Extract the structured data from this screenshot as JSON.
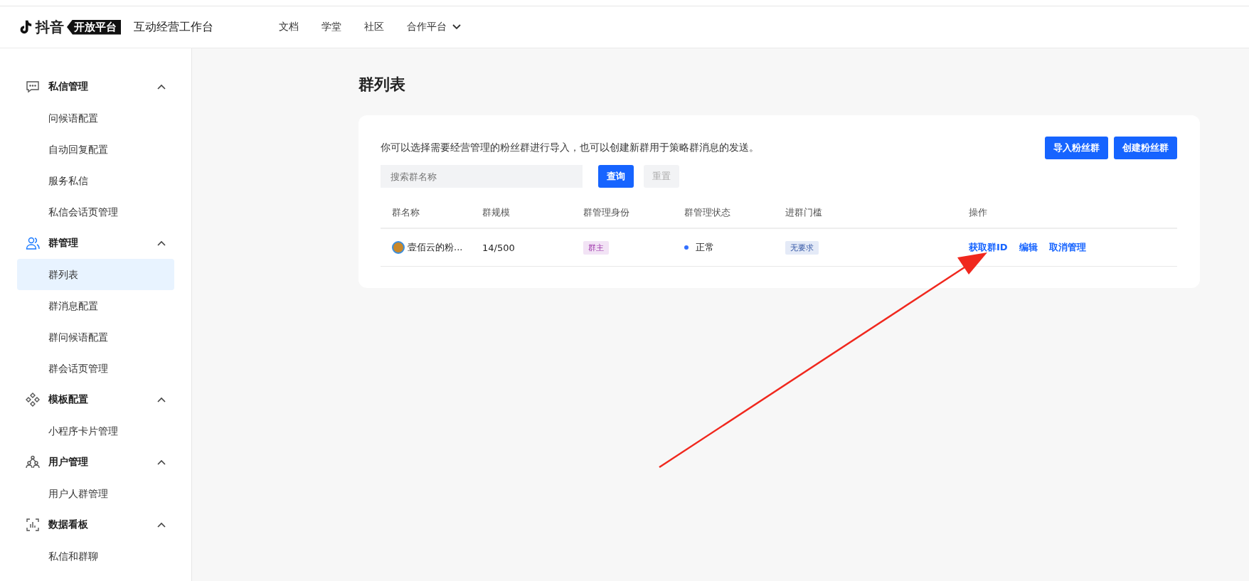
{
  "header": {
    "logo_text": "抖音",
    "logo_badge": "开放平台",
    "product": "互动经营工作台",
    "nav": [
      {
        "label": "文档",
        "dropdown": false
      },
      {
        "label": "学堂",
        "dropdown": false
      },
      {
        "label": "社区",
        "dropdown": false
      },
      {
        "label": "合作平台",
        "dropdown": true
      }
    ]
  },
  "sidebar": {
    "groups": [
      {
        "label": "私信管理",
        "kind": "chat",
        "expanded": true,
        "active": false,
        "children": [
          {
            "label": "问候语配置",
            "selected": false
          },
          {
            "label": "自动回复配置",
            "selected": false
          },
          {
            "label": "服务私信",
            "selected": false
          },
          {
            "label": "私信会话页管理",
            "selected": false
          }
        ]
      },
      {
        "label": "群管理",
        "kind": "users",
        "expanded": true,
        "active": true,
        "children": [
          {
            "label": "群列表",
            "selected": true
          },
          {
            "label": "群消息配置",
            "selected": false
          },
          {
            "label": "群问候语配置",
            "selected": false
          },
          {
            "label": "群会话页管理",
            "selected": false
          }
        ]
      },
      {
        "label": "模板配置",
        "kind": "diamonds",
        "expanded": true,
        "active": false,
        "children": [
          {
            "label": "小程序卡片管理",
            "selected": false
          }
        ]
      },
      {
        "label": "用户管理",
        "kind": "people",
        "expanded": true,
        "active": false,
        "children": [
          {
            "label": "用户人群管理",
            "selected": false
          }
        ]
      },
      {
        "label": "数据看板",
        "kind": "chart",
        "expanded": true,
        "active": false,
        "children": [
          {
            "label": "私信和群聊",
            "selected": false
          }
        ]
      }
    ]
  },
  "page": {
    "title": "群列表",
    "description": "你可以选择需要经营管理的粉丝群进行导入，也可以创建新群用于策略群消息的发送。",
    "actions": [
      "导入粉丝群",
      "创建粉丝群"
    ],
    "search": {
      "placeholder": "搜索群名称"
    },
    "query_button": "查询",
    "reset_button": {
      "label": "重置",
      "disabled": true
    },
    "table": {
      "columns": [
        "群名称",
        "群规模",
        "群管理身份",
        "群管理状态",
        "进群门槛",
        "操作"
      ],
      "rows": [
        {
          "name": "壹佰云的粉...",
          "size": "14/500",
          "role": "群主",
          "status": "正常",
          "color": "#3370ff",
          "threshold": "无要求",
          "operations": [
            "获取群ID",
            "编辑",
            "取消管理"
          ]
        }
      ]
    }
  }
}
